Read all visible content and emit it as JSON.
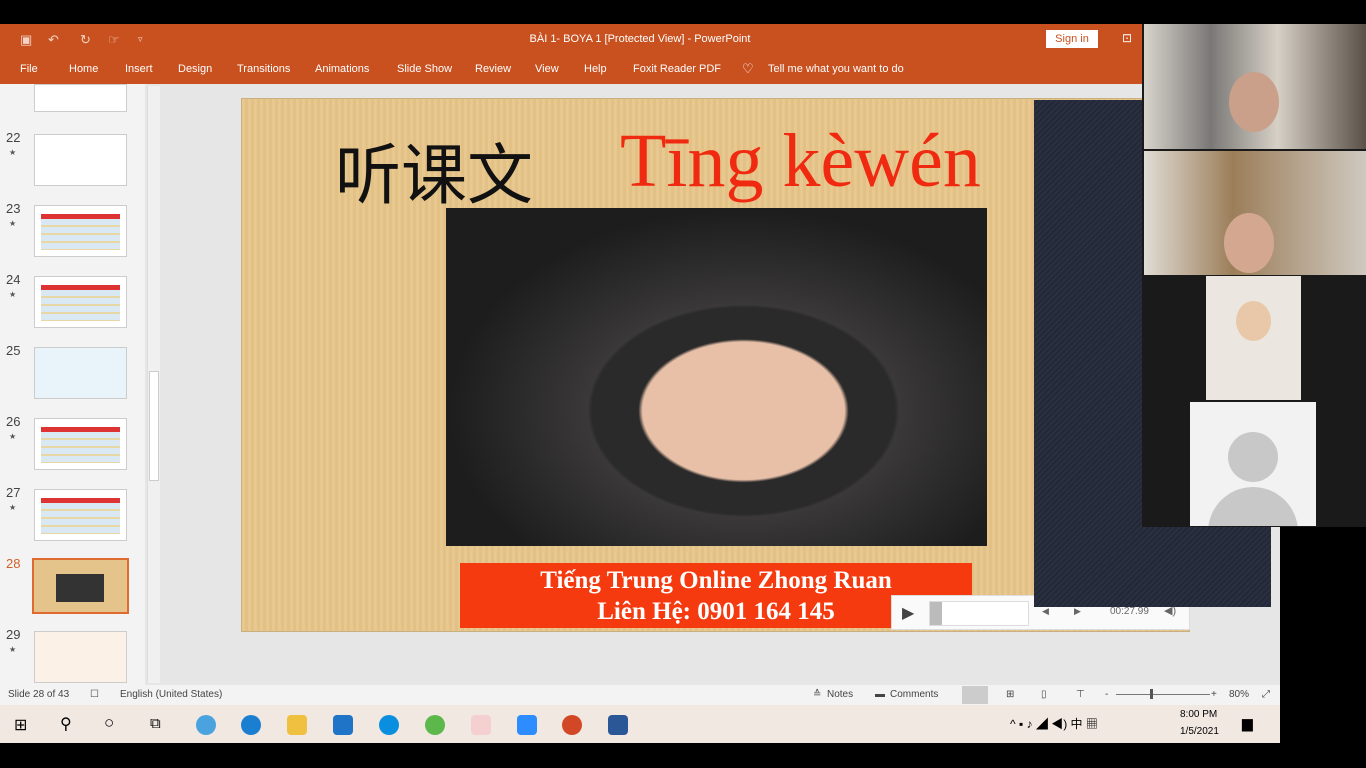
{
  "window": {
    "title": "BÀI 1- BOYA 1 [Protected View]  -  PowerPoint",
    "sign_in": "Sign in"
  },
  "menu": [
    "File",
    "Home",
    "Insert",
    "Design",
    "Transitions",
    "Animations",
    "Slide Show",
    "Review",
    "View",
    "Help",
    "Foxit Reader PDF"
  ],
  "tell_me": "Tell me what you want to do",
  "thumbnails": [
    {
      "n": "22"
    },
    {
      "n": "23"
    },
    {
      "n": "24"
    },
    {
      "n": "25"
    },
    {
      "n": "26"
    },
    {
      "n": "27"
    },
    {
      "n": "28",
      "selected": true
    },
    {
      "n": "29"
    }
  ],
  "slide": {
    "hanzi": "听课文",
    "pinyin": "Tīng kèwén",
    "banner_line1": "Tiếng Trung Online Zhong Ruan",
    "banner_line2": "Liên Hệ: 0901 164 145"
  },
  "player": {
    "time": "00:27.99",
    "progress": 0.02
  },
  "status": {
    "slide": "Slide 28 of 43",
    "language": "English (United States)",
    "notes": "Notes",
    "comments": "Comments",
    "zoom": "80%"
  },
  "clock": {
    "time": "8:00 PM",
    "date": "1/5/2021"
  },
  "colors": {
    "accent": "#c9501f",
    "banner": "#f53a10"
  }
}
